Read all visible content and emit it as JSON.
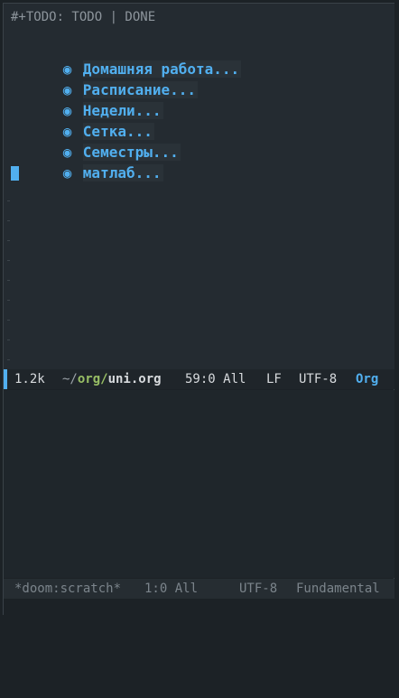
{
  "editor": {
    "todo_keywords_line": "#+TODO: TODO | DONE",
    "headings": [
      {
        "bullet": "◉",
        "label": "Домашняя работа..."
      },
      {
        "bullet": "◉",
        "label": "Расписание..."
      },
      {
        "bullet": "◉",
        "label": "Недели..."
      },
      {
        "bullet": "◉",
        "label": "Сетка..."
      },
      {
        "bullet": "◉",
        "label": "Семестры..."
      },
      {
        "bullet": "◉",
        "label": "матлаб..."
      }
    ]
  },
  "modeline_active": {
    "size": "1.2k",
    "path_tilde": "~/",
    "path_dir": "org/",
    "path_file": "uni.org",
    "position": "59:0 All",
    "eol": "LF",
    "encoding": "UTF-8",
    "major_mode": "Org"
  },
  "modeline_inactive": {
    "buffer": "*doom:scratch*",
    "position": "1:0 All",
    "encoding": "UTF-8",
    "major_mode": "Fundamental"
  },
  "colors": {
    "accent": "#51afef",
    "path_dir": "#98be65",
    "background": "#242b31"
  }
}
